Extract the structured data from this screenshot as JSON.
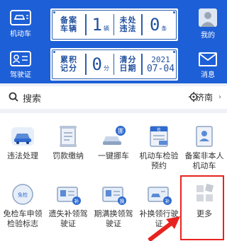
{
  "left_nav": [
    {
      "label": "机动车",
      "icon": "car-id-icon"
    },
    {
      "label": "驾驶证",
      "icon": "license-icon"
    }
  ],
  "right_nav": [
    {
      "label": "我的",
      "icon": "user-icon"
    },
    {
      "label": "消息",
      "icon": "mail-icon"
    }
  ],
  "plate1": {
    "left_label": "备案车辆",
    "count": "1",
    "count_unit": "辆",
    "right_label": "未处违法",
    "violations": "0",
    "violations_unit": "条"
  },
  "plate2": {
    "left_label": "累积记分",
    "points": "0",
    "points_unit": "分",
    "right_label": "清分日期",
    "date_year": "2021",
    "date_md": "07-04"
  },
  "search": {
    "label": "搜索",
    "city": "济南"
  },
  "services": [
    {
      "label": "违法处理",
      "icon": "car-violation-icon"
    },
    {
      "label": "罚款缴纳",
      "icon": "scroll-icon"
    },
    {
      "label": "一键挪车",
      "icon": "move-car-icon"
    },
    {
      "label": "机动车检验预约",
      "icon": "inspection-doc-icon"
    },
    {
      "label": "备案非本人机动车",
      "icon": "register-doc-icon"
    },
    {
      "label": "免检车申领检验标志",
      "icon": "exempt-tag-icon"
    },
    {
      "label": "遗失补领驾驶证",
      "icon": "lost-license-icon"
    },
    {
      "label": "期满换领驾驶证",
      "icon": "renew-license-icon"
    },
    {
      "label": "补换领行驶证",
      "icon": "replace-license-icon"
    },
    {
      "label": "更多",
      "icon": "more-grid-icon"
    }
  ],
  "colors": {
    "banner": "#1d5fd6",
    "highlight": "#e8231f",
    "plate_text": "#1f4f9e"
  }
}
